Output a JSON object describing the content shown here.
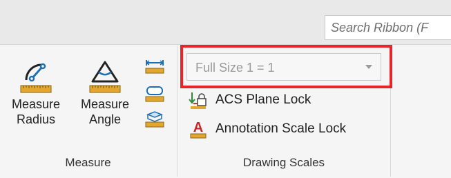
{
  "search": {
    "placeholder": "Search Ribbon (F"
  },
  "measure_group": {
    "label": "Measure",
    "buttons": [
      {
        "line1": "Measure",
        "line2": "Radius",
        "icon": "measure-radius-icon"
      },
      {
        "line1": "Measure",
        "line2": "Angle",
        "icon": "measure-angle-icon"
      }
    ],
    "small_icons": [
      "measure-distance-icon",
      "measure-area-icon",
      "measure-volume-icon"
    ]
  },
  "drawing_scales_group": {
    "label": "Drawing Scales",
    "scale_select": {
      "value": "Full Size 1 = 1"
    },
    "acs_plane_lock": {
      "label": "ACS Plane Lock",
      "icon": "acs-plane-lock-icon"
    },
    "annotation_scale_lock": {
      "label": "Annotation Scale Lock",
      "icon": "annotation-scale-lock-icon"
    }
  },
  "colors": {
    "highlight": "#e8242b",
    "ruler": "#e3a72f",
    "icon_blue": "#1f6fb5"
  }
}
